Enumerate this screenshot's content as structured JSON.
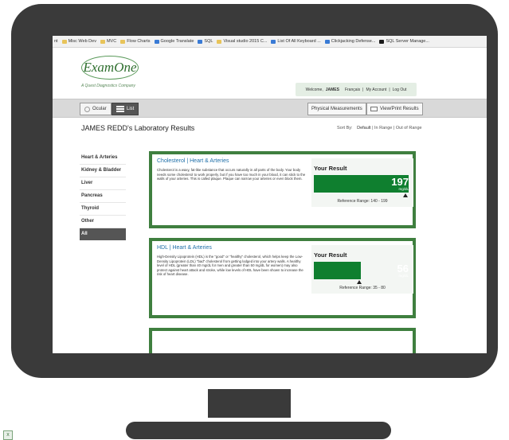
{
  "bookmarks": [
    "nt",
    "Misc Web Dev",
    "MVC",
    "Flow Charts",
    "Google Translate",
    "SQL",
    "Visual studio 2015 C...",
    "List Of All Keyboard ...",
    "Clickjacking Defense...",
    "SQL Server Manage..."
  ],
  "header": {
    "logo": "ExamOne",
    "tagline": "A Quest Diagnostics Company",
    "welcome": "Welcome,",
    "user": "JAMES",
    "language": "Français",
    "my_account": "My Account",
    "logout": "Log Out",
    "sep": "|"
  },
  "nav": {
    "ocular": "Ocular",
    "list": "List",
    "physical": "Physical Measurements",
    "print": "View/Print Results"
  },
  "results": {
    "title": "JAMES REDD's Laboratory Results",
    "sort_label": "Sort By:",
    "sort_default": "Default",
    "sort_in_range": "In Range",
    "sort_out_range": "Out of Range"
  },
  "sidebar": [
    "Heart & Arteries",
    "Kidney & Bladder",
    "Liver",
    "Pancreas",
    "Thyroid",
    "Other",
    "All"
  ],
  "cards": [
    {
      "title": "Cholesterol | Heart & Arteries",
      "desc": "Cholesterol is a waxy, fat-like substance that occurs naturally in all parts of the body. Your body needs some cholesterol to work properly, but if you have too much in your blood, it can stick to the walls of your arteries. This is called plaque. Plaque can narrow your arteries or even block them.",
      "your_result": "Your Result",
      "value": "197",
      "unit": "mg/dL",
      "reference": "Reference Range: 140 - 199",
      "level": 0.97,
      "marker": 0.92
    },
    {
      "title": "HDL | Heart & Arteries",
      "desc": "High-Density Lipoprotein (HDL) is the \"good\" or \"healthy\" cholesterol, which helps keep the Low-Density Lipoprotein (LDL) \"bad\" cholesterol from getting lodged into your artery walls. A healthy level of HDL (greater than 40 mg/dL for men and greater than 50 mg/dL for women) may also protect against heart attack and stroke, while low levels of HDL have been shown to increase the risk of heart disease.",
      "your_result": "Your Result",
      "value": "56",
      "unit": "mg/dL",
      "reference": "Reference Range: 35 - 80",
      "level": 0.48,
      "marker": 0.47
    }
  ],
  "colors": {
    "monitor": "#3a3a3a",
    "card_border": "#3f7f3f",
    "gauge": "#0f7f2f",
    "link": "#1f6fa8"
  }
}
